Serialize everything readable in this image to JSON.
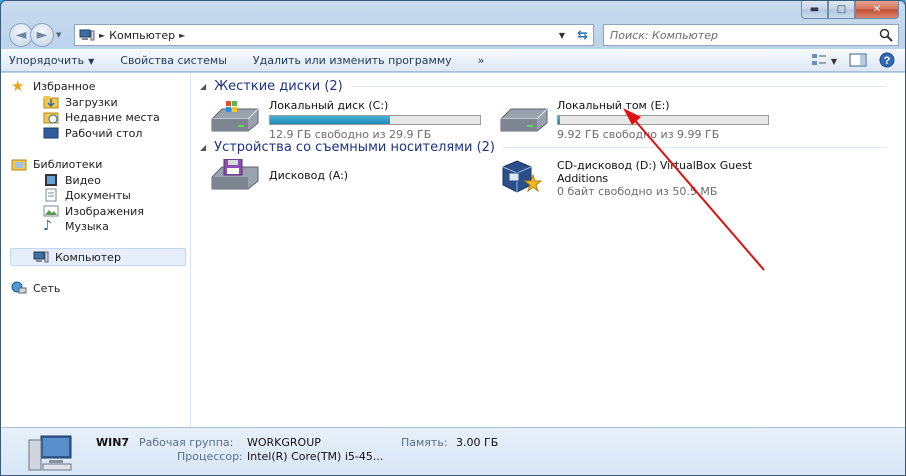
{
  "window": {
    "minimize": "▬",
    "maximize": "□",
    "close": "✕"
  },
  "address": {
    "path": "Компьютер",
    "separator": "►",
    "trailing_separator": "►"
  },
  "search": {
    "placeholder": "Поиск: Компьютер"
  },
  "toolbar": {
    "organize": "Упорядочить",
    "properties": "Свойства системы",
    "uninstall": "Удалить или изменить программу",
    "more": "»"
  },
  "nav": {
    "favorites": "Избранное",
    "downloads": "Загрузки",
    "recent": "Недавние места",
    "desktop": "Рабочий стол",
    "libraries": "Библиотеки",
    "video": "Видео",
    "documents": "Документы",
    "images": "Изображения",
    "music": "Музыка",
    "computer": "Компьютер",
    "network": "Сеть"
  },
  "groups": {
    "hard_disks": "Жесткие диски (2)",
    "removable": "Устройства со съемными носителями (2)"
  },
  "drives": {
    "c": {
      "name": "Локальный диск (C:)",
      "free": "12.9 ГБ свободно из 29.9 ГБ",
      "used_fraction": 0.57
    },
    "e": {
      "name": "Локальный том (E:)",
      "free": "9.92 ГБ свободно из 9.99 ГБ",
      "used_fraction": 0.01
    },
    "a": {
      "name": "Дисковод (A:)"
    },
    "d": {
      "name_line1": "CD-дисковод (D:) VirtualBox Guest",
      "name_line2": "Additions",
      "free": "0 байт свободно из 50.5 МБ"
    }
  },
  "details": {
    "computer_name": "WIN7",
    "workgroup_label": "Рабочая группа:",
    "workgroup_value": "WORKGROUP",
    "memory_label": "Память:",
    "memory_value": "3.00 ГБ",
    "cpu_label": "Процессор:",
    "cpu_value": "Intel(R) Core(TM) i5-45..."
  },
  "colors": {
    "annotation_arrow": "#e01010",
    "bar_fill": "#1f89b8",
    "group_header": "#1e3287"
  }
}
